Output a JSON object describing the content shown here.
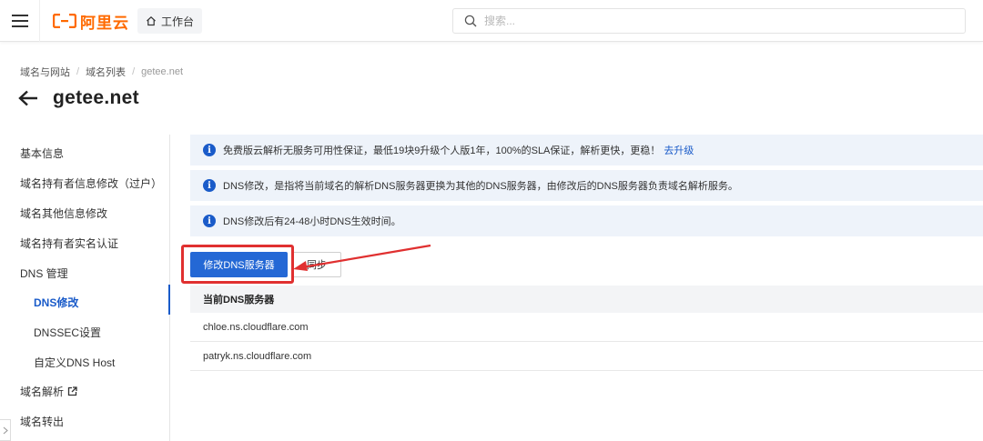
{
  "header": {
    "logo_text": "阿里云",
    "workbench_label": "工作台",
    "search_placeholder": "搜索..."
  },
  "breadcrumb": [
    "域名与网站",
    "域名列表",
    "getee.net"
  ],
  "page_title": "getee.net",
  "sidebar": {
    "items": [
      {
        "label": "基本信息"
      },
      {
        "label": "域名持有者信息修改（过户）"
      },
      {
        "label": "域名其他信息修改"
      },
      {
        "label": "域名持有者实名认证"
      },
      {
        "label": "DNS 管理"
      },
      {
        "label": "DNS修改",
        "active": true
      },
      {
        "label": "DNSSEC设置"
      },
      {
        "label": "自定义DNS Host"
      },
      {
        "label": "域名解析"
      },
      {
        "label": "域名转出"
      }
    ]
  },
  "notices": [
    {
      "text": "免费版云解析无服务可用性保证，最低19块9升级个人版1年，100%的SLA保证，解析更快，更稳！",
      "link": "去升级"
    },
    {
      "text": "DNS修改，是指将当前域名的解析DNS服务器更换为其他的DNS服务器，由修改后的DNS服务器负责域名解析服务。"
    },
    {
      "text": "DNS修改后有24-48小时DNS生效时间。"
    }
  ],
  "actions": {
    "modify_dns": "修改DNS服务器",
    "sync": "同步"
  },
  "dns_table": {
    "header": "当前DNS服务器",
    "rows": [
      "chloe.ns.cloudflare.com",
      "patryk.ns.cloudflare.com"
    ]
  },
  "colors": {
    "brand": "#ff6a00",
    "primary": "#2468d5",
    "highlight": "#e03030"
  }
}
